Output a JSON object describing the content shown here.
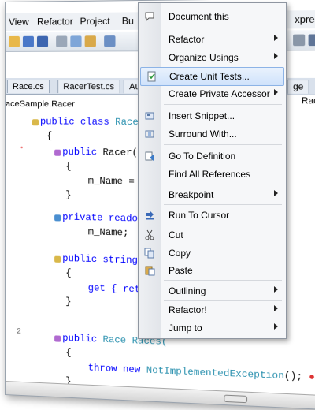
{
  "menubar": {
    "items": [
      "View",
      "Refactor",
      "Project",
      "Bu"
    ],
    "right_label": "xpress"
  },
  "tabs": {
    "items": [
      "Race.cs",
      "RacerTest.cs",
      "Auth"
    ],
    "right_fragments": [
      "ge",
      "Races"
    ]
  },
  "breadcrumb": "aceSample.Racer",
  "code": {
    "line1_kw": "public class ",
    "line1_type": "Racer",
    "line2": "{",
    "line3_kw": "public ",
    "line3_rest": "Racer(s",
    "line4": "{",
    "line5": "m_Name = n",
    "line6": "}",
    "line7_kw": "private readon",
    "line8": "m_Name;",
    "line9_kw": "public string",
    "line10": "{",
    "line11_kw": "get { retu",
    "line12": "}",
    "line13_kw": "public ",
    "line13_type": "Race ",
    "line13_rest": "Races(",
    "line14": "{",
    "line15_kw": "throw new ",
    "line15_type": "NotImplementedException",
    "line15_rest": "(); ",
    "line16": "}",
    "line_number": "2"
  },
  "context_menu": {
    "items": [
      {
        "label": "Document this",
        "icon": "speech-bubble-icon",
        "submenu": false
      },
      {
        "label": "Refactor",
        "icon": "",
        "submenu": true
      },
      {
        "label": "Organize Usings",
        "icon": "",
        "submenu": true
      },
      {
        "label": "Create Unit Tests...",
        "icon": "unit-test-icon",
        "submenu": false,
        "highlighted": true
      },
      {
        "label": "Create Private Accessor",
        "icon": "",
        "submenu": true
      },
      {
        "label": "Insert Snippet...",
        "icon": "snippet-icon",
        "submenu": false
      },
      {
        "label": "Surround With...",
        "icon": "surround-icon",
        "submenu": false
      },
      {
        "label": "Go To Definition",
        "icon": "definition-icon",
        "submenu": false
      },
      {
        "label": "Find All References",
        "icon": "",
        "submenu": false
      },
      {
        "label": "Breakpoint",
        "icon": "",
        "submenu": true
      },
      {
        "label": "Run To Cursor",
        "icon": "run-to-cursor-icon",
        "submenu": false
      },
      {
        "label": "Cut",
        "icon": "scissors-icon",
        "submenu": false
      },
      {
        "label": "Copy",
        "icon": "copy-icon",
        "submenu": false
      },
      {
        "label": "Paste",
        "icon": "paste-icon",
        "submenu": false
      },
      {
        "label": "Outlining",
        "icon": "",
        "submenu": true
      },
      {
        "label": "Refactor!",
        "icon": "",
        "submenu": true
      },
      {
        "label": "Jump to",
        "icon": "",
        "submenu": true
      }
    ]
  },
  "colors": {
    "keyword": "#0000ff",
    "type": "#2b91af",
    "menu_highlight": "#cfe2fb"
  }
}
